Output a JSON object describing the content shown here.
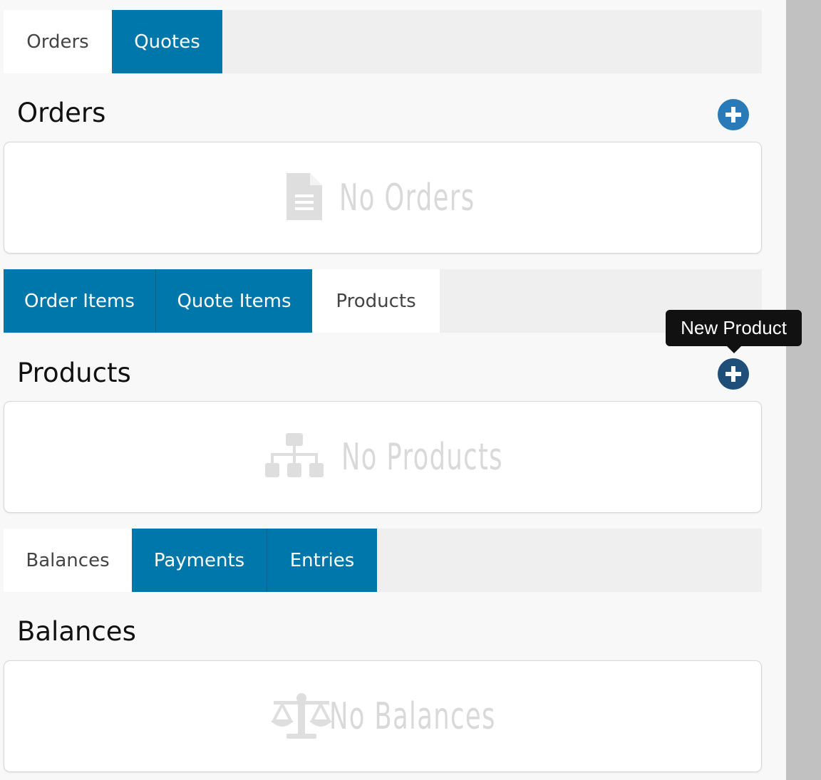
{
  "tabs_orders": [
    {
      "label": "Orders",
      "active": false
    },
    {
      "label": "Quotes",
      "active": true
    }
  ],
  "orders": {
    "title": "Orders",
    "empty_text": "No Orders"
  },
  "tabs_items": [
    {
      "label": "Order Items",
      "active": true
    },
    {
      "label": "Quote Items",
      "active": true
    },
    {
      "label": "Products",
      "active": false
    }
  ],
  "products": {
    "title": "Products",
    "empty_text": "No Products"
  },
  "tooltip": {
    "text": "New Product"
  },
  "tabs_balances": [
    {
      "label": "Balances",
      "active": false
    },
    {
      "label": "Payments",
      "active": true
    },
    {
      "label": "Entries",
      "active": true
    }
  ],
  "balances": {
    "title": "Balances",
    "empty_text": "No Balances"
  },
  "colors": {
    "tab_active": "#0077aa",
    "add_button": "#2a7ab8",
    "add_button_hover": "#1f4e79",
    "empty_state": "#d9d9d9"
  },
  "icons": {
    "add": "plus-circle-icon",
    "orders_empty": "document-icon",
    "products_empty": "sitemap-icon",
    "balances_empty": "balance-scale-icon"
  }
}
